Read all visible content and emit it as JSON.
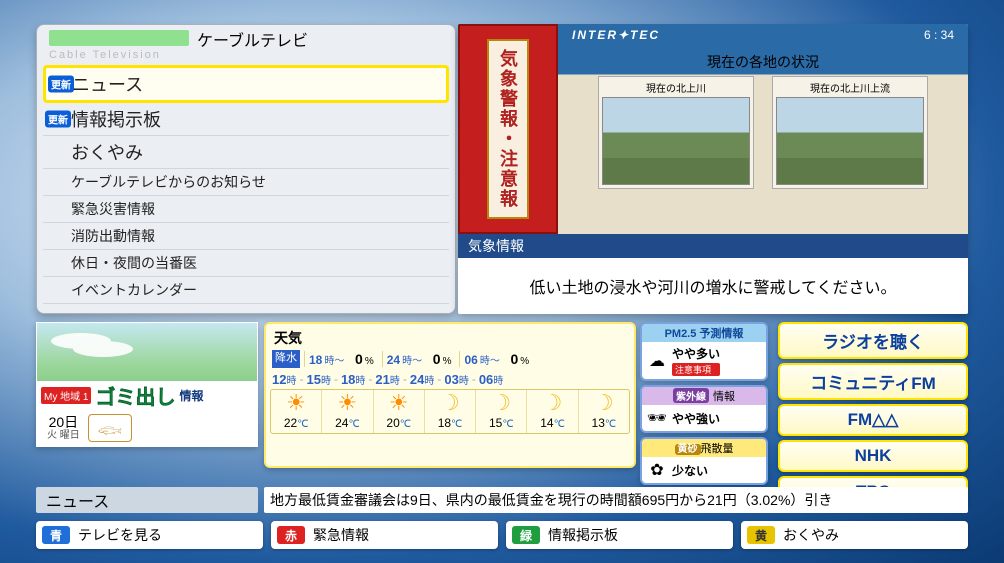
{
  "menu": {
    "title_jp": "ケーブルテレビ",
    "subtitle_en": "Cable Television",
    "update_badge": "更新",
    "items": [
      {
        "label": "ニュース",
        "updated": true,
        "selected": true
      },
      {
        "label": "情報掲示板",
        "updated": true
      },
      {
        "label": "おくやみ"
      },
      {
        "label": "ケーブルテレビからのお知らせ",
        "small": true
      },
      {
        "label": "緊急災害情報",
        "small": true
      },
      {
        "label": "消防出動情報",
        "small": true
      },
      {
        "label": "休日・夜間の当番医",
        "small": true
      },
      {
        "label": "イベントカレンダー",
        "small": true
      }
    ]
  },
  "broadcast": {
    "brand": "INTER✦TEC",
    "clock": "6 : 34",
    "red_banner": "気象警報・注意報",
    "cam_title": "現在の各地の状況",
    "cams": [
      {
        "label": "現在の北上川"
      },
      {
        "label": "現在の北上川上流"
      }
    ],
    "strip_header": "気象情報",
    "ticker": "低い土地の浸水や河川の増水に警戒してください。"
  },
  "local": {
    "region_prefix": "My 地域 1",
    "gomi_main": "ゴミ出し",
    "gomi_suffix": "情報",
    "date_day": "20日",
    "date_weekday_prefix": "火",
    "date_weekday_suffix": "曜日"
  },
  "weather": {
    "title": "天気",
    "precip_badge": "降水",
    "precip": [
      {
        "hour": "18",
        "pct": 0
      },
      {
        "hour": "24",
        "pct": 0
      },
      {
        "hour": "06",
        "pct": 0
      }
    ],
    "hour_suffix": "時～",
    "pct_suffix": "%",
    "timeline_hours": [
      "12",
      "15",
      "18",
      "21",
      "24",
      "03",
      "06"
    ],
    "timeline_suffix": "時",
    "forecast": [
      {
        "icon": "☀",
        "temp": 22
      },
      {
        "icon": "☀",
        "temp": 24
      },
      {
        "icon": "☀",
        "temp": 20
      },
      {
        "icon": "☽",
        "temp": 18
      },
      {
        "icon": "☽",
        "temp": 15
      },
      {
        "icon": "☽",
        "temp": 14
      },
      {
        "icon": "☽",
        "temp": 13
      }
    ],
    "temp_unit": "℃"
  },
  "env": {
    "pm": {
      "head": "PM2.5 予測情報",
      "text": "やや多い",
      "warn": "注意事項"
    },
    "uv": {
      "badge": "紫外線",
      "suffix": "情報",
      "text": "やや強い"
    },
    "pollen": {
      "badge": "黄砂",
      "suffix": "飛散量",
      "text": "少ない"
    }
  },
  "radio": {
    "buttons": [
      "ラジオを聴く",
      "コミュニティFM",
      "FM△△",
      "NHK",
      "TBS"
    ]
  },
  "news": {
    "label": "ニュース",
    "body": "地方最低賃金審議会は9日、県内の最低賃金を現行の時間額695円から21円（3.02%）引き"
  },
  "keys": [
    {
      "color": "blue",
      "chip": "青",
      "label": "テレビを見る"
    },
    {
      "color": "red",
      "chip": "赤",
      "label": "緊急情報"
    },
    {
      "color": "green",
      "chip": "緑",
      "label": "情報掲示板"
    },
    {
      "color": "yellow",
      "chip": "黄",
      "label": "おくやみ"
    }
  ]
}
